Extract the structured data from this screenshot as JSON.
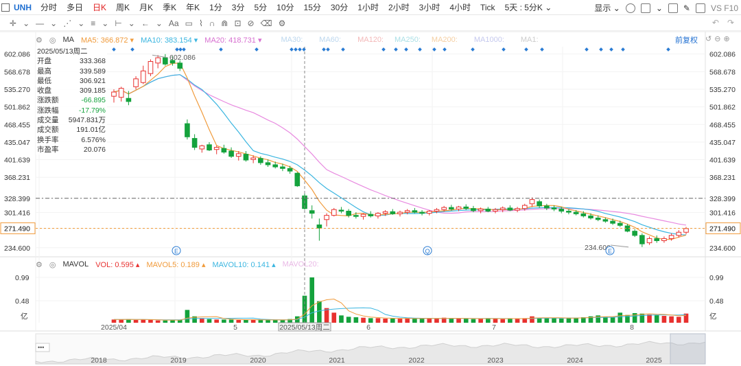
{
  "topbar": {
    "symbol": "UNH",
    "periods": [
      "分时",
      "多日",
      "日K",
      "周K",
      "月K",
      "季K",
      "年K",
      "1分",
      "3分",
      "5分",
      "10分",
      "15分",
      "30分",
      "1小时",
      "2小时",
      "3小时",
      "4小时",
      "Tick",
      "5天 : 5分K"
    ],
    "active_period": "日K",
    "display_label": "显示",
    "right_tail": "VS  F10"
  },
  "ma_header": {
    "indicator": "MA",
    "ma5_label": "MA5:",
    "ma5_value": "366.872",
    "ma10_label": "MA10:",
    "ma10_value": "383.154",
    "ma20_label": "MA20:",
    "ma20_value": "418.731",
    "ma30_label": "MA30:",
    "ma60_label": "MA60:",
    "ma120_label": "MA120:",
    "ma250_label": "MA250:",
    "ma200_label": "MA200:",
    "ma1000_label": "MA1000:",
    "ma1_label": "MA1:",
    "restore_label": "前复权"
  },
  "vol_header": {
    "indicator": "MAVOL",
    "vol_label": "VOL:",
    "vol_value": "0.595",
    "mavol5_label": "MAVOL5:",
    "mavol5_value": "0.189",
    "mavol10_label": "MAVOL10:",
    "mavol10_value": "0.141",
    "mavol20_label": "MAVOL20:"
  },
  "info_panel": {
    "date": "2025/05/13周二",
    "rows": [
      {
        "label": "开盘",
        "value": "333.368"
      },
      {
        "label": "最高",
        "value": "339.589"
      },
      {
        "label": "最低",
        "value": "306.921"
      },
      {
        "label": "收盘",
        "value": "309.185"
      },
      {
        "label": "涨跌额",
        "value": "-66.895"
      },
      {
        "label": "涨跌幅",
        "value": "-17.79%"
      },
      {
        "label": "成交量",
        "value": "5947.831万"
      },
      {
        "label": "成交额",
        "value": "191.01亿"
      },
      {
        "label": "换手率",
        "value": "6.576%"
      },
      {
        "label": "市盈率",
        "value": "20.076"
      }
    ]
  },
  "price_axis": [
    "602.086",
    "568.678",
    "535.270",
    "501.862",
    "468.455",
    "435.047",
    "401.639",
    "368.231",
    "328.399",
    "301.416",
    "271.490",
    "234.600"
  ],
  "price_markers": {
    "hline_dash": "328.399",
    "last_price": "271.490",
    "high_label": "602.086",
    "low_label": "234.600"
  },
  "volume_axis": [
    "0.99",
    "0.48",
    "亿"
  ],
  "x_axis_months": [
    "2025/04",
    "5",
    "6",
    "7",
    "8"
  ],
  "crosshair_date": "2025/05/13周二",
  "overview_years": [
    "2018",
    "2019",
    "2020",
    "2021",
    "2022",
    "2023",
    "2024",
    "2025"
  ],
  "event_markers": [
    "E",
    "Q",
    "E"
  ],
  "colors": {
    "up": "#e8312f",
    "down": "#14a23c",
    "ma5": "#f09a3a",
    "ma10": "#39b5e0",
    "ma20": "#e88ae0",
    "accent": "#1f6fd1",
    "event": "#2b7cd3"
  },
  "chart_data": {
    "type": "candlestick",
    "y_range": [
      234.6,
      602.086
    ],
    "candles": [
      {
        "o": 522,
        "h": 535,
        "l": 510,
        "c": 530
      },
      {
        "o": 520,
        "h": 540,
        "l": 512,
        "c": 537
      },
      {
        "o": 518,
        "h": 532,
        "l": 505,
        "c": 512
      },
      {
        "o": 540,
        "h": 560,
        "l": 535,
        "c": 555
      },
      {
        "o": 548,
        "h": 580,
        "l": 545,
        "c": 570
      },
      {
        "o": 565,
        "h": 592,
        "l": 560,
        "c": 588
      },
      {
        "o": 585,
        "h": 600,
        "l": 575,
        "c": 595
      },
      {
        "o": 595,
        "h": 602,
        "l": 580,
        "c": 583
      },
      {
        "o": 590,
        "h": 598,
        "l": 580,
        "c": 585
      },
      {
        "o": 585,
        "h": 590,
        "l": 570,
        "c": 575
      },
      {
        "o": 470,
        "h": 478,
        "l": 440,
        "c": 445
      },
      {
        "o": 442,
        "h": 450,
        "l": 420,
        "c": 425
      },
      {
        "o": 422,
        "h": 430,
        "l": 415,
        "c": 428
      },
      {
        "o": 430,
        "h": 435,
        "l": 418,
        "c": 420
      },
      {
        "o": 421,
        "h": 428,
        "l": 412,
        "c": 425
      },
      {
        "o": 423,
        "h": 430,
        "l": 413,
        "c": 416
      },
      {
        "o": 418,
        "h": 425,
        "l": 405,
        "c": 408
      },
      {
        "o": 408,
        "h": 418,
        "l": 400,
        "c": 413
      },
      {
        "o": 412,
        "h": 418,
        "l": 398,
        "c": 401
      },
      {
        "o": 402,
        "h": 410,
        "l": 395,
        "c": 405
      },
      {
        "o": 404,
        "h": 408,
        "l": 392,
        "c": 396
      },
      {
        "o": 396,
        "h": 402,
        "l": 388,
        "c": 392
      },
      {
        "o": 392,
        "h": 398,
        "l": 385,
        "c": 388
      },
      {
        "o": 388,
        "h": 394,
        "l": 380,
        "c": 385
      },
      {
        "o": 385,
        "h": 390,
        "l": 375,
        "c": 380
      },
      {
        "o": 376,
        "h": 378,
        "l": 350,
        "c": 352
      },
      {
        "o": 333,
        "h": 340,
        "l": 307,
        "c": 309
      },
      {
        "o": 305,
        "h": 315,
        "l": 290,
        "c": 300
      },
      {
        "o": 278,
        "h": 290,
        "l": 248,
        "c": 272
      },
      {
        "o": 288,
        "h": 300,
        "l": 275,
        "c": 296
      },
      {
        "o": 296,
        "h": 310,
        "l": 294,
        "c": 307
      },
      {
        "o": 306,
        "h": 312,
        "l": 300,
        "c": 304
      },
      {
        "o": 304,
        "h": 308,
        "l": 292,
        "c": 296
      },
      {
        "o": 296,
        "h": 302,
        "l": 290,
        "c": 294
      },
      {
        "o": 294,
        "h": 300,
        "l": 288,
        "c": 298
      },
      {
        "o": 298,
        "h": 304,
        "l": 292,
        "c": 295
      },
      {
        "o": 295,
        "h": 302,
        "l": 290,
        "c": 300
      },
      {
        "o": 300,
        "h": 306,
        "l": 295,
        "c": 303
      },
      {
        "o": 303,
        "h": 308,
        "l": 297,
        "c": 299
      },
      {
        "o": 299,
        "h": 305,
        "l": 294,
        "c": 302
      },
      {
        "o": 302,
        "h": 308,
        "l": 298,
        "c": 305
      },
      {
        "o": 305,
        "h": 310,
        "l": 300,
        "c": 302
      },
      {
        "o": 302,
        "h": 306,
        "l": 296,
        "c": 300
      },
      {
        "o": 300,
        "h": 306,
        "l": 296,
        "c": 304
      },
      {
        "o": 304,
        "h": 310,
        "l": 300,
        "c": 307
      },
      {
        "o": 307,
        "h": 314,
        "l": 303,
        "c": 311
      },
      {
        "o": 311,
        "h": 316,
        "l": 305,
        "c": 308
      },
      {
        "o": 308,
        "h": 314,
        "l": 304,
        "c": 312
      },
      {
        "o": 312,
        "h": 317,
        "l": 306,
        "c": 309
      },
      {
        "o": 309,
        "h": 314,
        "l": 302,
        "c": 305
      },
      {
        "o": 305,
        "h": 311,
        "l": 300,
        "c": 308
      },
      {
        "o": 308,
        "h": 312,
        "l": 302,
        "c": 304
      },
      {
        "o": 304,
        "h": 310,
        "l": 300,
        "c": 307
      },
      {
        "o": 307,
        "h": 313,
        "l": 302,
        "c": 310
      },
      {
        "o": 310,
        "h": 315,
        "l": 304,
        "c": 306
      },
      {
        "o": 306,
        "h": 312,
        "l": 302,
        "c": 309
      },
      {
        "o": 309,
        "h": 318,
        "l": 305,
        "c": 315
      },
      {
        "o": 318,
        "h": 330,
        "l": 312,
        "c": 326
      },
      {
        "o": 322,
        "h": 326,
        "l": 310,
        "c": 314
      },
      {
        "o": 314,
        "h": 318,
        "l": 306,
        "c": 310
      },
      {
        "o": 310,
        "h": 315,
        "l": 304,
        "c": 308
      },
      {
        "o": 308,
        "h": 312,
        "l": 300,
        "c": 304
      },
      {
        "o": 304,
        "h": 308,
        "l": 298,
        "c": 302
      },
      {
        "o": 302,
        "h": 306,
        "l": 296,
        "c": 299
      },
      {
        "o": 299,
        "h": 304,
        "l": 292,
        "c": 295
      },
      {
        "o": 295,
        "h": 300,
        "l": 288,
        "c": 291
      },
      {
        "o": 291,
        "h": 296,
        "l": 285,
        "c": 288
      },
      {
        "o": 288,
        "h": 292,
        "l": 282,
        "c": 285
      },
      {
        "o": 285,
        "h": 290,
        "l": 278,
        "c": 281
      },
      {
        "o": 281,
        "h": 286,
        "l": 274,
        "c": 277
      },
      {
        "o": 276,
        "h": 280,
        "l": 264,
        "c": 266
      },
      {
        "o": 266,
        "h": 270,
        "l": 255,
        "c": 258
      },
      {
        "o": 258,
        "h": 262,
        "l": 236,
        "c": 242
      },
      {
        "o": 244,
        "h": 256,
        "l": 240,
        "c": 252
      },
      {
        "o": 252,
        "h": 258,
        "l": 244,
        "c": 248
      },
      {
        "o": 248,
        "h": 256,
        "l": 244,
        "c": 252
      },
      {
        "o": 252,
        "h": 262,
        "l": 248,
        "c": 258
      },
      {
        "o": 258,
        "h": 268,
        "l": 254,
        "c": 264
      },
      {
        "o": 264,
        "h": 274,
        "l": 260,
        "c": 271
      }
    ],
    "volume": [
      0.07,
      0.07,
      0.08,
      0.06,
      0.07,
      0.06,
      0.05,
      0.05,
      0.06,
      0.06,
      0.28,
      0.14,
      0.1,
      0.08,
      0.07,
      0.07,
      0.07,
      0.06,
      0.06,
      0.07,
      0.06,
      0.06,
      0.06,
      0.06,
      0.08,
      0.14,
      0.59,
      0.99,
      0.47,
      0.32,
      0.22,
      0.16,
      0.13,
      0.12,
      0.11,
      0.1,
      0.1,
      0.09,
      0.09,
      0.09,
      0.1,
      0.09,
      0.09,
      0.1,
      0.09,
      0.11,
      0.09,
      0.09,
      0.09,
      0.08,
      0.09,
      0.1,
      0.09,
      0.08,
      0.09,
      0.09,
      0.1,
      0.14,
      0.11,
      0.1,
      0.1,
      0.09,
      0.11,
      0.11,
      0.12,
      0.14,
      0.16,
      0.13,
      0.12,
      0.22,
      0.17,
      0.21,
      0.2,
      0.18,
      0.17,
      0.15,
      0.14,
      0.13,
      0.2
    ]
  }
}
